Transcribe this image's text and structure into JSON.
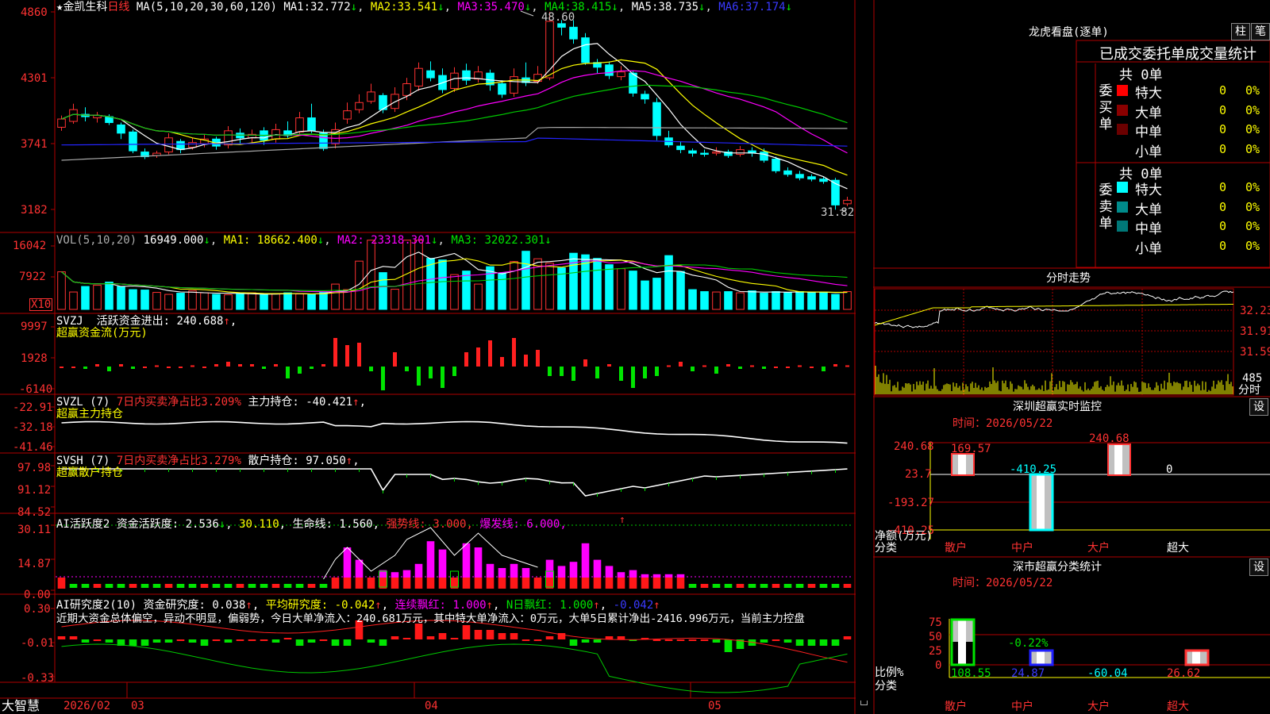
{
  "bottom": {
    "brand": "大智慧",
    "date0": "2026/02",
    "m03": "03",
    "m04": "04",
    "m05": "05"
  },
  "k": {
    "star": "★",
    "name": "金凯生科",
    "period": "日线",
    "ma_label": "MA(5,10,20,30,60,120)",
    "ma": [
      {
        "k": "MA1:",
        "v": "32.772",
        "a": "↓"
      },
      {
        "k": "MA2:",
        "v": "33.541",
        "a": "↓"
      },
      {
        "k": "MA3:",
        "v": "35.470",
        "a": "↓"
      },
      {
        "k": "MA4:",
        "v": "38.415",
        "a": "↓"
      },
      {
        "k": "MA5:",
        "v": "38.735",
        "a": "↓"
      },
      {
        "k": "MA6:",
        "v": "37.174",
        "a": "↓"
      }
    ],
    "yticks": [
      "4860",
      "4301",
      "3741",
      "3182"
    ],
    "high_label": "48.60",
    "low_label": "31.82"
  },
  "vol": {
    "title": "VOL(5,10,20)",
    "v": "16949.000",
    "a": "↓",
    "ma": [
      {
        "k": "MA1:",
        "v": "18662.400",
        "a": "↓"
      },
      {
        "k": "MA2:",
        "v": "23318.301",
        "a": "↓"
      },
      {
        "k": "MA3:",
        "v": "32022.301",
        "a": "↓"
      }
    ],
    "yticks": [
      "16042",
      "7922"
    ],
    "unit": "X10"
  },
  "svzj": {
    "title": "SVZJ",
    "label": "活跃资金进出:",
    "v": "240.688",
    "a": "↑",
    "sep": ",",
    "sub": "超赢资金流(万元)",
    "yticks": [
      "9997",
      "1928",
      "-6140"
    ]
  },
  "svzl": {
    "title": "SVZL (7)",
    "p": "7日内买卖净占比3.209%",
    "label": "主力持仓:",
    "v": "-40.421",
    "a": "↑",
    "sep": ",",
    "sub": "超赢主力持仓",
    "yticks": [
      "-22.91",
      "-32.18",
      "-41.46"
    ]
  },
  "svsh": {
    "title": "SVSH (7)",
    "p": "7日内买卖净占比3.279%",
    "label": "散户持仓:",
    "v": "97.050",
    "a": "↑",
    "sep": ",",
    "sub": "超赢散户持仓",
    "yticks": [
      "97.98",
      "91.12",
      "84.52"
    ]
  },
  "ai1": {
    "title": "AI活跃度2",
    "l1": "资金活跃度:",
    "v1": "2.536",
    "a1": "↓",
    "v2": "30.110",
    "sep": ",",
    "l3": "生命线:",
    "v3": "1.560",
    "l4": "强势线:",
    "v4": "3.000",
    "l5": "爆发线:",
    "v5": "6.000",
    "yticks": [
      "30.11",
      "14.87",
      "0.00"
    ]
  },
  "ai2": {
    "title": "AI研究度2(10)",
    "l1": "资金研究度:",
    "v1": "0.038",
    "a1": "↑",
    "l2": "平均研究度:",
    "v2": "-0.042",
    "a2": "↑",
    "l3": "连续飘红:",
    "v3": "1.000",
    "a3": "↑",
    "l4": "N日飘红:",
    "v4": "1.000",
    "a4": "↑",
    "v5": "-0.042",
    "a5": "↑",
    "sep": ",",
    "summary": "近期大资金总体偏空，异动不明显，偏弱势，今日大单净流入：240.681万元，其中特大单净流入：0万元，大单5日累计净出-2416.996万元，当前主力控盘",
    "yticks": [
      "0.30",
      "-0.01",
      "-0.33"
    ]
  },
  "lhkp": {
    "title": "龙虎看盘(逐单)",
    "btn1": "柱",
    "btn2": "笔",
    "heading": "已成交委托单成交量统计",
    "buy": {
      "side": "委买单",
      "total": "共 0单",
      "rows": [
        {
          "name": "特大",
          "c": "0",
          "p": "0%",
          "color": "#ff0000"
        },
        {
          "name": "大单",
          "c": "0",
          "p": "0%",
          "color": "#8b0000"
        },
        {
          "name": "中单",
          "c": "0",
          "p": "0%",
          "color": "#6b0000"
        },
        {
          "name": "小单",
          "c": "0",
          "p": "0%",
          "color": "#000000"
        }
      ]
    },
    "sell": {
      "side": "委卖单",
      "total": "共 0单",
      "rows": [
        {
          "name": "特大",
          "c": "0",
          "p": "0%",
          "color": "#00ffff"
        },
        {
          "name": "大单",
          "c": "0",
          "p": "0%",
          "color": "#008b8b"
        },
        {
          "name": "中单",
          "c": "0",
          "p": "0%",
          "color": "#007878"
        },
        {
          "name": "小单",
          "c": "0",
          "p": "0%",
          "color": "#000000"
        }
      ]
    }
  },
  "fs": {
    "title": "分时走势",
    "yticks": [
      "32.23",
      "31.91",
      "31.59"
    ],
    "vol_tick": "485",
    "unit": "分时"
  },
  "sz1": {
    "title": "深圳超赢实时监控",
    "btn": "设",
    "time": "时间：2026/05/22",
    "yticks": [
      "240.68",
      "23.7",
      "-193.27",
      "-410.25"
    ],
    "ylabel": "净额(万元)",
    "xlabel": "分类",
    "cats": [
      "散户",
      "中户",
      "大户",
      "超大"
    ],
    "vals": [
      "169.57",
      "-410.25",
      "240.68",
      "0"
    ]
  },
  "sz2": {
    "title": "深市超赢分类统计",
    "btn": "设",
    "time": "时间：2026/05/22",
    "yticks": [
      "75",
      "50",
      "25",
      "0"
    ],
    "ylabel": "比例%",
    "xlabel": "分类",
    "top_label": "-0.22%",
    "cats": [
      "散户",
      "中户",
      "大户",
      "超大"
    ],
    "vals": [
      "108.55",
      "24.87",
      "-60.04",
      "26.62"
    ]
  },
  "chart_data": [
    {
      "type": "candlestick",
      "title": "金凯生科 日线",
      "ylim": [
        31.82,
        48.6
      ],
      "yticks": [
        48.6,
        43.01,
        37.41,
        31.82
      ],
      "x_axis_labels": [
        "2026/02",
        "03",
        "04",
        "05"
      ],
      "high": 48.6,
      "last_low": 31.82,
      "ma_last": {
        "MA1": 32.772,
        "MA2": 33.541,
        "MA3": 35.47,
        "MA4": 38.415,
        "MA5": 38.735,
        "MA6": 37.174
      },
      "candles": [
        [
          38.8,
          39.5,
          39.8,
          38.5
        ],
        [
          39.3,
          40.3,
          40.8,
          39.1
        ],
        [
          39.9,
          39.7,
          40.5,
          39.3
        ],
        [
          39.6,
          39.8,
          40.1,
          39.2
        ],
        [
          39.7,
          39.2,
          39.9,
          39.0
        ],
        [
          39.0,
          38.3,
          39.2,
          37.8
        ],
        [
          38.4,
          36.8,
          38.6,
          36.6
        ],
        [
          36.7,
          36.3,
          37.0,
          36.1
        ],
        [
          36.4,
          36.6,
          36.8,
          36.2
        ],
        [
          36.7,
          37.9,
          38.3,
          36.5
        ],
        [
          37.6,
          36.9,
          37.8,
          36.6
        ],
        [
          37.1,
          37.5,
          37.9,
          36.9
        ],
        [
          37.4,
          37.8,
          38.2,
          37.1
        ],
        [
          37.8,
          37.2,
          38.0,
          36.9
        ],
        [
          37.3,
          38.5,
          38.9,
          37.0
        ],
        [
          38.3,
          37.9,
          38.7,
          37.4
        ],
        [
          37.9,
          38.2,
          38.6,
          37.5
        ],
        [
          38.5,
          37.7,
          38.8,
          37.3
        ],
        [
          37.8,
          38.6,
          39.1,
          37.5
        ],
        [
          38.5,
          38.1,
          39.3,
          37.9
        ],
        [
          38.4,
          39.6,
          40.1,
          38.2
        ],
        [
          39.6,
          38.5,
          40.8,
          38.3
        ],
        [
          38.3,
          37.0,
          38.6,
          36.8
        ],
        [
          37.4,
          38.6,
          39.2,
          37.0
        ],
        [
          39.5,
          40.2,
          40.9,
          39.1
        ],
        [
          40.3,
          40.9,
          41.6,
          40.0
        ],
        [
          41.0,
          41.8,
          42.5,
          40.8
        ],
        [
          41.5,
          40.3,
          41.7,
          40.0
        ],
        [
          40.4,
          41.6,
          42.2,
          40.1
        ],
        [
          41.5,
          42.5,
          43.0,
          41.1
        ],
        [
          42.3,
          43.8,
          44.3,
          41.9
        ],
        [
          43.6,
          43.0,
          44.4,
          42.7
        ],
        [
          43.2,
          42.0,
          43.8,
          41.7
        ],
        [
          42.1,
          43.4,
          43.9,
          41.8
        ],
        [
          43.6,
          42.8,
          44.2,
          42.4
        ],
        [
          42.9,
          43.5,
          44.0,
          42.6
        ],
        [
          43.4,
          42.4,
          43.7,
          41.9
        ],
        [
          42.5,
          41.6,
          42.8,
          41.3
        ],
        [
          41.7,
          43.1,
          43.8,
          41.4
        ],
        [
          43.0,
          42.6,
          44.3,
          42.3
        ],
        [
          42.7,
          43.3,
          44.0,
          42.5
        ],
        [
          43.0,
          47.8,
          48.6,
          42.8
        ],
        [
          47.6,
          47.3,
          47.9,
          46.6
        ],
        [
          47.3,
          46.3,
          47.9,
          45.9
        ],
        [
          46.4,
          44.3,
          46.8,
          44.1
        ],
        [
          44.3,
          43.9,
          44.6,
          43.4
        ],
        [
          44.1,
          43.2,
          44.4,
          42.9
        ],
        [
          43.1,
          43.5,
          44.0,
          42.8
        ],
        [
          43.4,
          41.7,
          43.6,
          41.4
        ],
        [
          41.6,
          41.2,
          41.9,
          40.8
        ],
        [
          40.9,
          38.1,
          41.3,
          37.7
        ],
        [
          37.9,
          37.3,
          38.5,
          37.1
        ],
        [
          37.2,
          36.9,
          37.6,
          36.6
        ],
        [
          36.8,
          36.6,
          37.0,
          36.3
        ],
        [
          36.6,
          36.5,
          36.9,
          36.3
        ],
        [
          36.6,
          36.7,
          37.1,
          36.4
        ],
        [
          36.7,
          36.4,
          36.9,
          36.2
        ],
        [
          36.5,
          36.9,
          37.2,
          36.3
        ],
        [
          36.8,
          36.6,
          37.1,
          36.3
        ],
        [
          36.7,
          36.0,
          37.0,
          35.8
        ],
        [
          36.1,
          35.1,
          36.3,
          34.9
        ],
        [
          35.1,
          34.8,
          35.4,
          34.6
        ],
        [
          34.8,
          34.5,
          35.1,
          34.3
        ],
        [
          34.6,
          34.4,
          34.8,
          34.2
        ],
        [
          34.4,
          34.2,
          34.6,
          34.0
        ],
        [
          34.3,
          32.2,
          34.5,
          31.8
        ],
        [
          32.3,
          32.6,
          32.9,
          32.1
        ]
      ]
    },
    {
      "type": "bar",
      "title": "VOL(5,10,20)",
      "ylim": [
        0,
        16042
      ],
      "yticks": [
        16042,
        7922
      ],
      "values": [
        9500,
        4400,
        5800,
        6100,
        6900,
        5800,
        5000,
        4900,
        4300,
        3800,
        4100,
        4700,
        4200,
        3800,
        3700,
        3900,
        4200,
        3700,
        3900,
        4200,
        3900,
        3900,
        4300,
        6400,
        5000,
        12200,
        21400,
        9300,
        5100,
        18400,
        18100,
        12900,
        12500,
        8800,
        9700,
        6400,
        10800,
        9200,
        12100,
        14700,
        12800,
        11700,
        10500,
        14200,
        13800,
        12900,
        11300,
        10300,
        9700,
        7200,
        7900,
        13600,
        9600,
        5000,
        4500,
        4400,
        4500,
        4200,
        4700,
        4100,
        4500,
        4300,
        4500,
        4400,
        4300,
        3800,
        4500,
        3000,
        3700,
        4100,
        3400,
        3300,
        4200,
        3700,
        4000,
        3500,
        3500,
        4500
      ],
      "ma": [
        {
          "name": "MA1",
          "value": 18662.4
        },
        {
          "name": "MA2",
          "value": 23318.301
        },
        {
          "name": "MA3",
          "value": 32022.301
        }
      ]
    }
  ]
}
